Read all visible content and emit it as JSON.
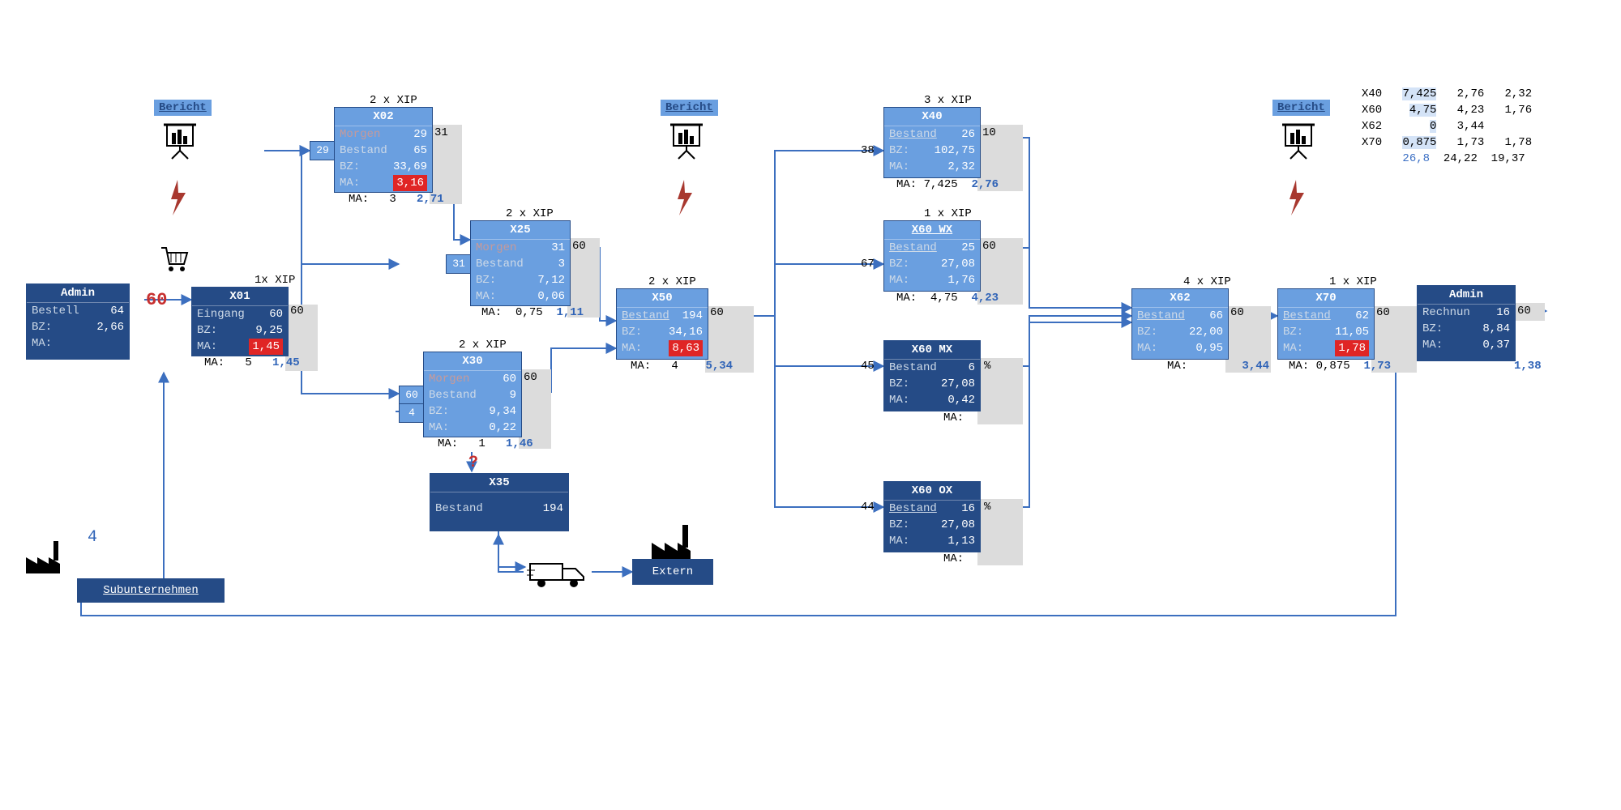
{
  "labels": {
    "bericht": "Bericht",
    "extern": "Extern",
    "subunternehmen": "Subunternehmen",
    "qmark": "?",
    "in60": "60",
    "in4": "4"
  },
  "adminL": {
    "title": "Admin",
    "rows": {
      "k1": "Bestell",
      "v1": "64",
      "k2": "BZ:",
      "v2": "2,66",
      "k3": "MA:",
      "v3": ""
    }
  },
  "adminR": {
    "title": "Admin",
    "rows": {
      "k1": "Rechnun",
      "v1": "16",
      "k2": "BZ:",
      "v2": "8,84",
      "k3": "MA:",
      "v3": "0,37"
    },
    "xip": "1 x XIP",
    "out": "60",
    "maFoot": "1,38"
  },
  "x01": {
    "title": "X01",
    "xip": "1x XIP",
    "rows": {
      "k1": "Eingang",
      "v1": "60",
      "k2": "BZ:",
      "v2": "9,25",
      "k3": "MA:",
      "v3": "1,45"
    },
    "maA": "5",
    "maB": "1,45",
    "out": "60"
  },
  "x02": {
    "title": "X02",
    "xip": "2 x XIP",
    "rows": {
      "k0": "Morgen",
      "v0": "29",
      "k1": "Bestand",
      "v1": "65",
      "k2": "BZ:",
      "v2": "33,69",
      "k3": "MA:",
      "v3": "3,16"
    },
    "maA": "3",
    "maB": "2,71",
    "out": "31",
    "side": "29"
  },
  "x25": {
    "title": "X25",
    "xip": "2 x XIP",
    "rows": {
      "k0": "Morgen",
      "v0": "31",
      "k1": "Bestand",
      "v1": "3",
      "k2": "BZ:",
      "v2": "7,12",
      "k3": "MA:",
      "v3": "0,06"
    },
    "maA": "0,75",
    "maB": "1,11",
    "out": "60",
    "side": "31"
  },
  "x30": {
    "title": "X30",
    "xip": "2 x XIP",
    "rows": {
      "k0": "Morgen",
      "v0": "60",
      "k1": "Bestand",
      "v1": "9",
      "k2": "BZ:",
      "v2": "9,34",
      "k3": "MA:",
      "v3": "0,22"
    },
    "maA": "1",
    "maB": "1,46",
    "out": "60",
    "sideA": "60",
    "sideB": "4"
  },
  "x35": {
    "title": "X35",
    "rows": {
      "k1": "Bestand",
      "v1": "194"
    }
  },
  "x50": {
    "title": "X50",
    "xip": "2 x XIP",
    "rows": {
      "k1": "Bestand",
      "v1": "194",
      "k2": "BZ:",
      "v2": "34,16",
      "k3": "MA:",
      "v3": "8,63"
    },
    "maA": "4",
    "maB": "5,34",
    "out": "60"
  },
  "x40": {
    "title": "X40",
    "xip": "3 x XIP",
    "rows": {
      "k1": "Bestand",
      "v1": "26",
      "k2": "BZ:",
      "v2": "102,75",
      "k3": "MA:",
      "v3": "2,32"
    },
    "maA": "7,425",
    "maB": "2,76",
    "out": "10",
    "side": "38"
  },
  "x60wx": {
    "title": "X60 WX",
    "xip": "1 x XIP",
    "rows": {
      "k1": "Bestand",
      "v1": "25",
      "k2": "BZ:",
      "v2": "27,08",
      "k3": "MA:",
      "v3": "1,76"
    },
    "maA": "4,75",
    "maB": "4,23",
    "out": "60",
    "side": "67"
  },
  "x60mx": {
    "title": "X60 MX",
    "rows": {
      "k1": "Bestand",
      "v1": "6",
      "k2": "BZ:",
      "v2": "27,08",
      "k3": "MA:",
      "v3": "0,42"
    },
    "maA": "",
    "out": "%",
    "side": "45"
  },
  "x60ox": {
    "title": "X60 OX",
    "rows": {
      "k1": "Bestand",
      "v1": "16",
      "k2": "BZ:",
      "v2": "27,08",
      "k3": "MA:",
      "v3": "1,13"
    },
    "maA": "",
    "out": "%",
    "side": "44"
  },
  "x62": {
    "title": "X62",
    "xip": "4 x XIP",
    "rows": {
      "k1": "Bestand",
      "v1": "66",
      "k2": "BZ:",
      "v2": "22,00",
      "k3": "MA:",
      "v3": "0,95"
    },
    "maA": "",
    "maB": "3,44",
    "out": "60"
  },
  "x70": {
    "title": "X70",
    "xip": "1 x XIP",
    "rows": {
      "k1": "Bestand",
      "v1": "62",
      "k2": "BZ:",
      "v2": "11,05",
      "k3": "MA:",
      "v3": "1,78"
    },
    "maA": "0,875",
    "maB": "1,73",
    "out": "60"
  },
  "table": {
    "r1": {
      "n": "X40",
      "a": "7,425",
      "b": "2,76",
      "c": "2,32"
    },
    "r2": {
      "n": "X60",
      "a": "4,75",
      "b": "4,23",
      "c": "1,76"
    },
    "r3": {
      "n": "X62",
      "a": "0",
      "b": "3,44",
      "c": ""
    },
    "r4": {
      "n": "X70",
      "a": "0,875",
      "b": "1,73",
      "c": "1,78"
    },
    "sum": {
      "a": "26,8",
      "b": "24,22",
      "c": "19,37"
    }
  }
}
